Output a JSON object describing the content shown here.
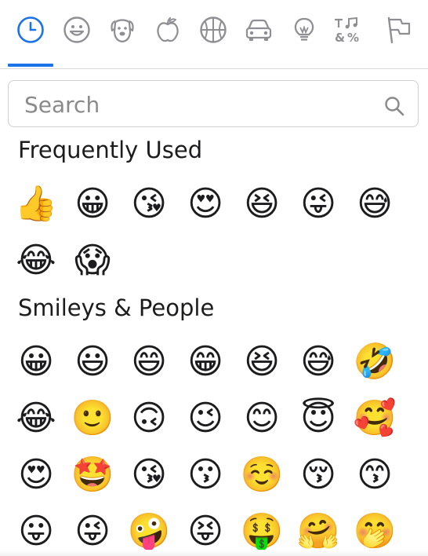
{
  "tabs": [
    {
      "name": "recent",
      "selected": true,
      "icon": "clock-icon"
    },
    {
      "name": "smileys",
      "icon": "smiley-icon"
    },
    {
      "name": "animals",
      "icon": "dog-icon"
    },
    {
      "name": "food",
      "icon": "apple-icon"
    },
    {
      "name": "activities",
      "icon": "basketball-icon"
    },
    {
      "name": "travel",
      "icon": "car-icon"
    },
    {
      "name": "objects",
      "icon": "lightbulb-icon"
    },
    {
      "name": "symbols",
      "icon": "symbols-icon"
    },
    {
      "name": "flags",
      "icon": "flag-icon"
    }
  ],
  "colors": {
    "accent": "#1a73e8",
    "icon_gray": "#8e8e93"
  },
  "search": {
    "placeholder": "Search",
    "value": ""
  },
  "sections": [
    {
      "title": "Frequently Used",
      "emojis": [
        "👍",
        "😀",
        "😘",
        "😍",
        "😆",
        "😜",
        "😅",
        "😂",
        "😱"
      ]
    },
    {
      "title": "Smileys & People",
      "emojis": [
        "😀",
        "😃",
        "😄",
        "😁",
        "😆",
        "😅",
        "🤣",
        "😂",
        "🙂",
        "🙃",
        "😉",
        "😊",
        "😇",
        "🥰",
        "😍",
        "🤩",
        "😘",
        "😗",
        "☺️",
        "😚",
        "😙",
        "😛",
        "😜",
        "🤪",
        "😝",
        "🤑",
        "🤗",
        "🤭"
      ]
    }
  ]
}
